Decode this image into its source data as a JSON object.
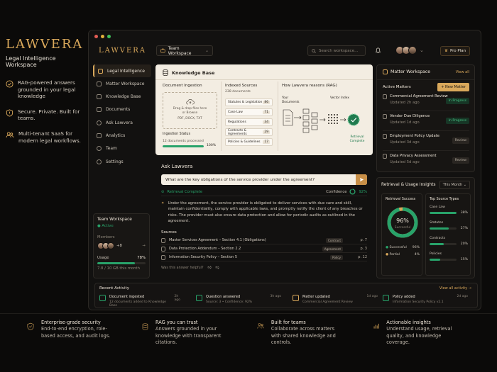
{
  "marketing": {
    "brand": "LAWVERA",
    "subtitle": "Legal Intelligence Workspace",
    "features": [
      {
        "icon": "check-circle-icon",
        "text": "RAG-powered answers grounded in your legal knowledge"
      },
      {
        "icon": "shield-icon",
        "text": "Secure. Private. Built for teams."
      },
      {
        "icon": "users-icon",
        "text": "Multi-tenant SaaS for modern legal workflows."
      }
    ]
  },
  "topbar": {
    "logo": "LAWVERA",
    "workspace": "Team Workspace",
    "search_placeholder": "Search workspace...",
    "plan": "Pro Plan"
  },
  "sidebar": {
    "items": [
      {
        "label": "Legal Intelligence",
        "icon": "scale-icon"
      },
      {
        "label": "Matter Workspace",
        "icon": "briefcase-icon"
      },
      {
        "label": "Knowledge Base",
        "icon": "book-icon"
      },
      {
        "label": "Documents",
        "icon": "document-icon"
      },
      {
        "label": "Ask Lawvera",
        "icon": "chat-icon"
      },
      {
        "label": "Analytics",
        "icon": "chart-icon"
      },
      {
        "label": "Team",
        "icon": "users-icon"
      },
      {
        "label": "Settings",
        "icon": "gear-icon"
      }
    ],
    "team_card": {
      "title": "Team Workspace",
      "status": "Active",
      "members_label": "Members",
      "members_extra": "+8",
      "usage_label": "Usage",
      "usage_pct": "78%",
      "usage_fraction": 0.78,
      "usage_detail": "7.8 / 10 GB this month"
    }
  },
  "knowledge_base": {
    "title": "Knowledge Base",
    "ingestion": {
      "header": "Document Ingestion",
      "drop_text_1": "Drag & drop files here",
      "drop_text_2": "or Browse",
      "drop_formats": "PDF, DOCX, TXT",
      "status_label": "Ingestion Status",
      "status_detail": "12 documents processed",
      "progress_pct": "100%",
      "progress_fraction": 1.0
    },
    "indexed": {
      "header": "Indexed Sources",
      "count": "238 documents",
      "rows": [
        {
          "name": "Statutes & Legislation",
          "count": "86"
        },
        {
          "name": "Case Law",
          "count": "71"
        },
        {
          "name": "Regulations",
          "count": "34"
        },
        {
          "name": "Contracts & Agreements",
          "count": "29"
        },
        {
          "name": "Policies & Guidelines",
          "count": "17"
        }
      ]
    },
    "rag": {
      "header": "How Lawvera reasons (RAG)",
      "label_docs": "Your Documents",
      "label_index": "Vector Index",
      "label_complete": "Retrieval Complete"
    }
  },
  "ask": {
    "title": "Ask Lawvera",
    "question": "What are the key obligations of the service provider under the agreement?",
    "retrieval": "Retrieval Complete",
    "confidence_label": "Confidence",
    "confidence": "92%",
    "answer": "Under the agreement, the service provider is obligated to deliver services with due care and skill, maintain confidentiality, comply with applicable laws, and promptly notify the client of any breaches or risks. The provider must also ensure data protection and allow for periodic audits as outlined in the agreement.",
    "sources_label": "Sources",
    "sources": [
      {
        "n": "1",
        "title": "Master Services Agreement – Section 4.1 (Obligations)",
        "tag": "Contract",
        "page": "p. 7"
      },
      {
        "n": "2",
        "title": "Data Protection Addendum – Section 2.2",
        "tag": "Agreement",
        "page": "p. 3"
      },
      {
        "n": "3",
        "title": "Information Security Policy – Section 5",
        "tag": "Policy",
        "page": "p. 12"
      }
    ],
    "feedback": "Was this answer helpful?"
  },
  "matters": {
    "title": "Matter Workspace",
    "view_all": "View all",
    "active_label": "Active Matters",
    "new_button": "+ New Matter",
    "items": [
      {
        "name": "Commercial Agreement Review",
        "updated": "Updated 2h ago",
        "status": "In Progress"
      },
      {
        "name": "Vendor Due Diligence",
        "updated": "Updated 1d ago",
        "status": "In Progress"
      },
      {
        "name": "Employment Policy Update",
        "updated": "Updated 3d ago",
        "status": "Review"
      },
      {
        "name": "Data Privacy Assessment",
        "updated": "Updated 5d ago",
        "status": "Review"
      }
    ]
  },
  "insights": {
    "title": "Retrieval & Usage Insights",
    "period": "This Month",
    "success_label": "Retrieval Success",
    "success_pct": "96%",
    "success_sub": "Successful",
    "success_fraction": 0.96,
    "legend": [
      {
        "label": "Successful",
        "value": "96%",
        "color": "#28a36a"
      },
      {
        "label": "Partial",
        "value": "4%",
        "color": "#d9a85b"
      }
    ],
    "types_label": "Top Source Types",
    "types": [
      {
        "name": "Case Law",
        "pct": "38%",
        "fraction": 0.38
      },
      {
        "name": "Statutes",
        "pct": "27%",
        "fraction": 0.27
      },
      {
        "name": "Contracts",
        "pct": "20%",
        "fraction": 0.2
      },
      {
        "name": "Policies",
        "pct": "15%",
        "fraction": 0.15
      }
    ]
  },
  "recent": {
    "title": "Recent Activity",
    "view_all": "View all activity →",
    "items": [
      {
        "title": "Document ingested",
        "detail": "12 documents added to Knowledge Base",
        "time": "2h ago"
      },
      {
        "title": "Question answered",
        "detail": "Source: 3 • Confidence: 92%",
        "time": "3h ago"
      },
      {
        "title": "Matter updated",
        "detail": "Commercial Agreement Review",
        "time": "1d ago"
      },
      {
        "title": "Policy added",
        "detail": "Information Security Policy v2.1",
        "time": "2d ago"
      }
    ]
  },
  "bottom": [
    {
      "icon": "shield-icon",
      "title": "Enterprise-grade security",
      "text": "End-to-end encryption, role-based access, and audit logs."
    },
    {
      "icon": "database-icon",
      "title": "RAG you can trust",
      "text": "Answers grounded in your knowledge with transparent citations."
    },
    {
      "icon": "users-icon",
      "title": "Built for teams",
      "text": "Collaborate across matters with shared knowledge and controls."
    },
    {
      "icon": "chart-icon",
      "title": "Actionable insights",
      "text": "Understand usage, retrieval quality, and knowledge coverage."
    }
  ]
}
